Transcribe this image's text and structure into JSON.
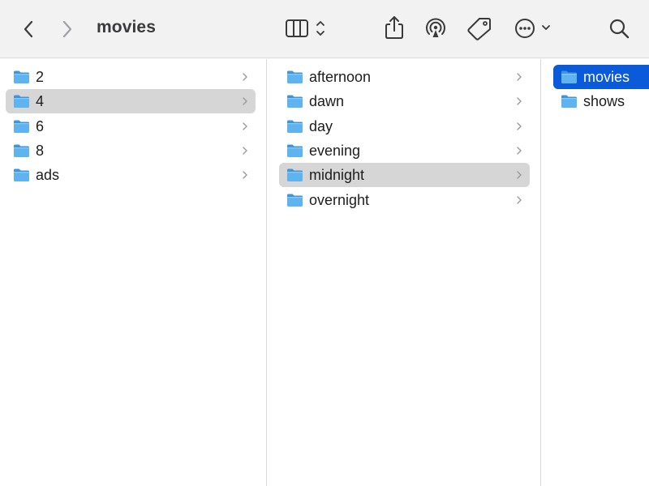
{
  "toolbar": {
    "title": "movies",
    "back_icon": "chevron-left-icon",
    "forward_icon": "chevron-right-icon",
    "view_icon": "column-view-icon",
    "share_icon": "share-icon",
    "airdrop_icon": "airdrop-icon",
    "tag_icon": "tag-icon",
    "more_icon": "ellipsis-circle-icon",
    "search_icon": "search-icon"
  },
  "columns": [
    {
      "items": [
        {
          "label": "2",
          "selected": "none"
        },
        {
          "label": "4",
          "selected": "gray"
        },
        {
          "label": "6",
          "selected": "none"
        },
        {
          "label": "8",
          "selected": "none"
        },
        {
          "label": "ads",
          "selected": "none"
        }
      ]
    },
    {
      "items": [
        {
          "label": "afternoon",
          "selected": "none"
        },
        {
          "label": "dawn",
          "selected": "none"
        },
        {
          "label": "day",
          "selected": "none"
        },
        {
          "label": "evening",
          "selected": "none"
        },
        {
          "label": "midnight",
          "selected": "gray"
        },
        {
          "label": "overnight",
          "selected": "none"
        }
      ]
    },
    {
      "items": [
        {
          "label": "movies",
          "selected": "blue"
        },
        {
          "label": "shows",
          "selected": "none"
        }
      ]
    }
  ],
  "colors": {
    "accent": "#0a5ad9",
    "selection_gray": "#d6d6d6",
    "folder_blue": "#5fb4f0"
  }
}
